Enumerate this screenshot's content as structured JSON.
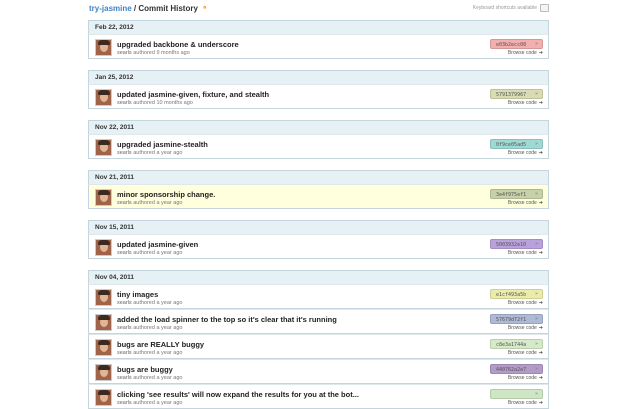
{
  "header": {
    "repo": "try-jasmine",
    "separator": " / ",
    "page": "Commit History",
    "rss_icon": "rss-icon",
    "shortcuts_label": "Keyboard shortcuts available",
    "keyboard_icon": "keyboard-icon"
  },
  "browse_label": "Browse code",
  "days": [
    {
      "date": "Feb 22, 2012",
      "commits": [
        {
          "message": "upgraded backbone & underscore",
          "author": "searls",
          "verb": "authored",
          "time": "9 months ago",
          "sha": "e03b2ecc08",
          "sha_color": "#f3aeae",
          "highlight": false
        }
      ]
    },
    {
      "date": "Jan 25, 2012",
      "commits": [
        {
          "message": "updated jasmine-given, fixture, and stealth",
          "author": "searls",
          "verb": "authored",
          "time": "10 months ago",
          "sha": "5791379967",
          "sha_color": "#d9dcb1",
          "highlight": false
        }
      ]
    },
    {
      "date": "Nov 22, 2011",
      "commits": [
        {
          "message": "upgraded jasmine-stealth",
          "author": "searls",
          "verb": "authored",
          "time": "a year ago",
          "sha": "0f9ce05ad5",
          "sha_color": "#9fd9d4",
          "highlight": false
        }
      ]
    },
    {
      "date": "Nov 21, 2011",
      "commits": [
        {
          "message": "minor sponsorship change.",
          "author": "searls",
          "verb": "authored",
          "time": "a year ago",
          "sha": "3e4f975ef1",
          "sha_color": "#c6d1a9",
          "highlight": true
        }
      ]
    },
    {
      "date": "Nov 15, 2011",
      "commits": [
        {
          "message": "updated jasmine-given",
          "author": "searls",
          "verb": "authored",
          "time": "a year ago",
          "sha": "5003932e10",
          "sha_color": "#b9a2dc",
          "highlight": false
        }
      ]
    },
    {
      "date": "Nov 04, 2011",
      "commits": [
        {
          "message": "tiny images",
          "author": "searls",
          "verb": "authored",
          "time": "a year ago",
          "sha": "e1cf493a5b",
          "sha_color": "#ececaa",
          "highlight": false
        },
        {
          "message": "added the load spinner to the top so it's clear that it's running",
          "author": "searls",
          "verb": "authored",
          "time": "a year ago",
          "sha": "57679d72f1",
          "sha_color": "#aeb9d6",
          "highlight": false
        },
        {
          "message": "bugs are REALLY buggy",
          "author": "searls",
          "verb": "authored",
          "time": "a year ago",
          "sha": "c8e3a1744a",
          "sha_color": "#d5ebc8",
          "highlight": false
        },
        {
          "message": "bugs are buggy",
          "author": "searls",
          "verb": "authored",
          "time": "a year ago",
          "sha": "440762a2e7",
          "sha_color": "#b39bc9",
          "highlight": false
        },
        {
          "message": "clicking 'see results' will now expand the results for you at the bot...",
          "author": "searls",
          "verb": "authored",
          "time": "a year ago",
          "sha": "",
          "sha_color": "#cfe6c4",
          "highlight": false
        }
      ]
    }
  ]
}
